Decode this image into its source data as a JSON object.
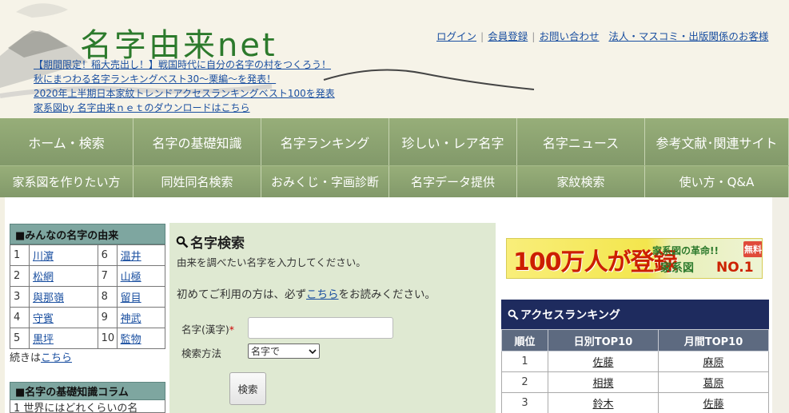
{
  "header": {
    "logo": "名字由来net",
    "news": [
      "【期間限定！稲大売出し！】戦国時代に自分の名字の村をつくろう！",
      "秋にまつわる名字ランキングベスト30～栗編～を発表！",
      "2020年上半期日本家紋トレンドアクセスランキングベスト100を発表",
      "家系図by 名字由来ｎｅｔのダウンロードはこちら"
    ],
    "toplinks": [
      "ログイン",
      "会員登録",
      "お問い合わせ",
      "法人・マスコミ・出版関係のお客様"
    ]
  },
  "nav": {
    "row1": [
      "ホーム・検索",
      "名字の基礎知識",
      "名字ランキング",
      "珍しい・レア名字",
      "名字ニュース",
      "参考文献･関連サイト"
    ],
    "row2": [
      "家系図を作りたい方",
      "同姓同名検索",
      "おみくじ・字画診断",
      "名字データ提供",
      "家紋検索",
      "使い方・Q&A"
    ]
  },
  "left": {
    "origin_title": "■みんなの名字の由来",
    "origin_rows": [
      [
        {
          "n": "1",
          "name": "川濵"
        },
        {
          "n": "6",
          "name": "温井"
        }
      ],
      [
        {
          "n": "2",
          "name": "松網"
        },
        {
          "n": "7",
          "name": "山極"
        }
      ],
      [
        {
          "n": "3",
          "name": "與那嶺"
        },
        {
          "n": "8",
          "name": "留目"
        }
      ],
      [
        {
          "n": "4",
          "name": "守賓"
        },
        {
          "n": "9",
          "name": "神武"
        }
      ],
      [
        {
          "n": "5",
          "name": "黒坪"
        },
        {
          "n": "10",
          "name": "監物"
        }
      ]
    ],
    "more_prefix": "続きは",
    "more_link": "こちら",
    "column_title": "■名字の基礎知識コラム",
    "column_first": "1 世界にはどれくらいの名"
  },
  "search": {
    "title": "名字検索",
    "desc": "由来を調べたい名字を入力してください。",
    "first_prefix": "初めてご利用の方は、必ず",
    "first_link": "こちら",
    "first_suffix": "をお読みください。",
    "name_label": "名字(漢字)",
    "required_mark": "*",
    "method_label": "検索方法",
    "method_value": "名字で",
    "button": "検索"
  },
  "banner": {
    "big": "100万人が登録",
    "small": "家系図の革命!!",
    "family": "家系図",
    "no1": "NO.1",
    "free": "無料"
  },
  "ranking": {
    "title": "アクセスランキング",
    "headers": [
      "順位",
      "日別TOP10",
      "月間TOP10"
    ],
    "rows": [
      {
        "rank": "1",
        "daily": "佐藤",
        "monthly": "麻原"
      },
      {
        "rank": "2",
        "daily": "相撲",
        "monthly": "葛原"
      },
      {
        "rank": "3",
        "daily": "鈴木",
        "monthly": "佐藤"
      }
    ]
  },
  "colors": {
    "nav": "#8da66d",
    "panel": "#dfe9d2",
    "rank_head": "#1e2b5e",
    "accent_link": "#1a4fa0"
  }
}
